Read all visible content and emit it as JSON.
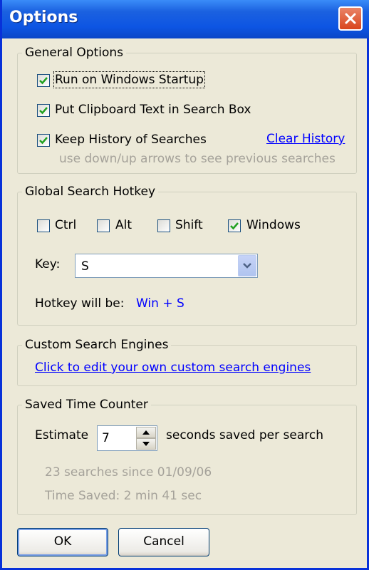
{
  "window": {
    "title": "Options"
  },
  "general": {
    "legend": "General Options",
    "run_startup": {
      "label": "Run on Windows Startup",
      "checked": true
    },
    "clipboard": {
      "label": "Put Clipboard Text in Search Box",
      "checked": true
    },
    "history": {
      "label": "Keep History of Searches",
      "checked": true
    },
    "clear_history": "Clear History",
    "hint": "use down/up arrows to see previous searches"
  },
  "hotkey": {
    "legend": "Global Search Hotkey",
    "ctrl": {
      "label": "Ctrl",
      "checked": false
    },
    "alt": {
      "label": "Alt",
      "checked": false
    },
    "shift": {
      "label": "Shift",
      "checked": false
    },
    "windows": {
      "label": "Windows",
      "checked": true
    },
    "key_label": "Key:",
    "key_value": "S",
    "result_label": "Hotkey will be:",
    "result_value": "Win + S"
  },
  "custom": {
    "legend": "Custom Search Engines",
    "edit_link": "Click to edit your own custom search engines"
  },
  "counter": {
    "legend": "Saved Time Counter",
    "estimate_label": "Estimate",
    "estimate_value": "7",
    "estimate_suffix": "seconds saved per search",
    "searches_since": "23 searches since 01/09/06",
    "time_saved": "Time Saved: 2 min 41 sec"
  },
  "buttons": {
    "ok": "OK",
    "cancel": "Cancel"
  },
  "colors": {
    "titlebar": "#0a46c7",
    "dialog": "#ece9d8",
    "link": "#0000ff",
    "close": "#d9451c"
  },
  "icons": {
    "close": "close-icon",
    "check": "check-icon",
    "dropdown": "chevron-down-icon"
  }
}
